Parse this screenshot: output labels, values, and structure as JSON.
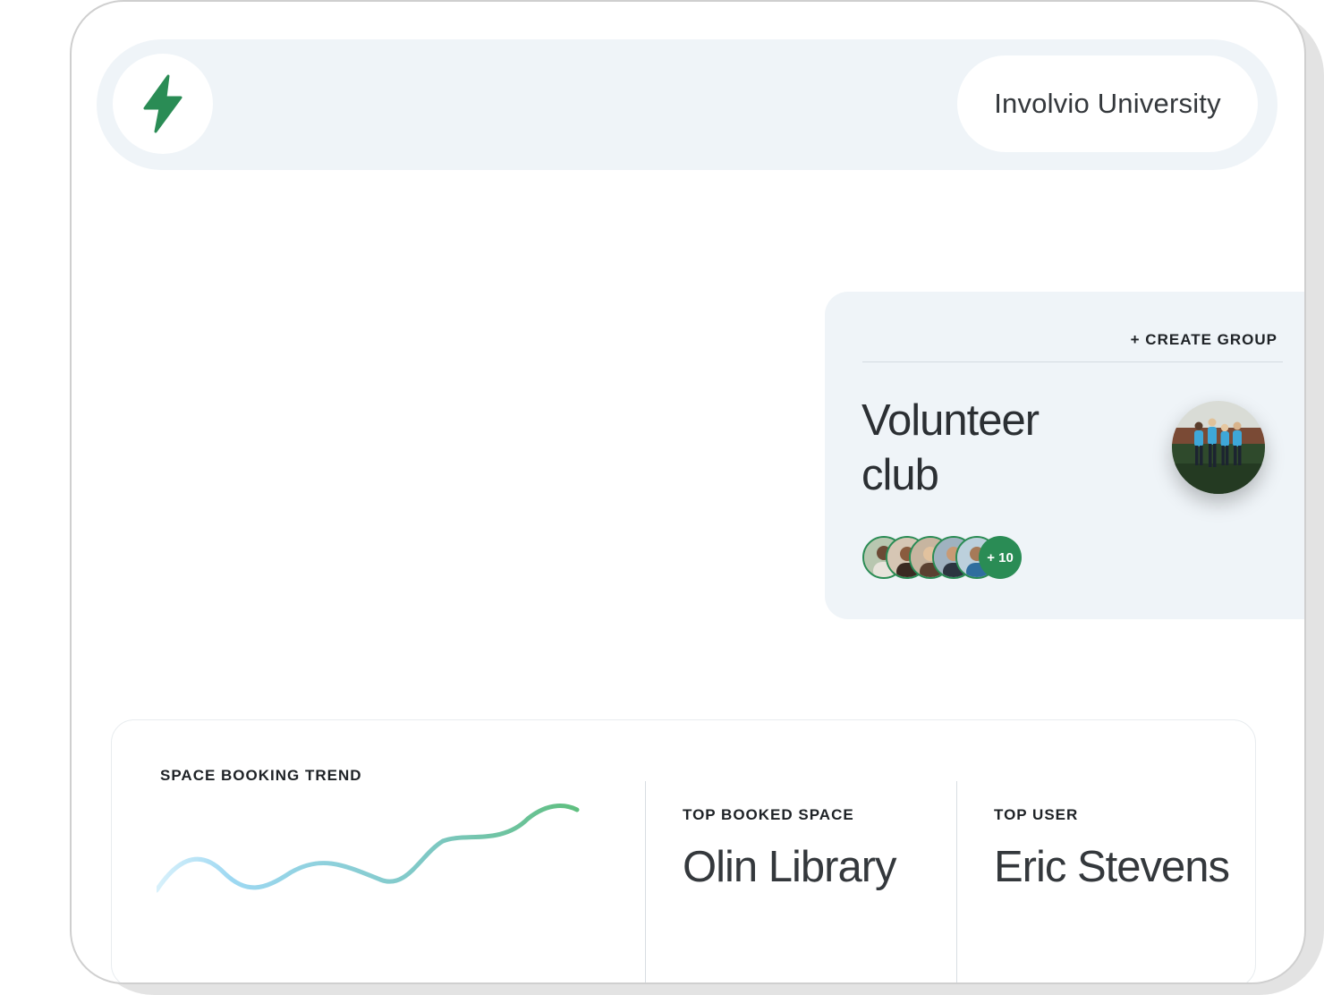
{
  "header": {
    "logo_icon": "lightning-bolt-icon",
    "accent_color": "#2a8c55",
    "org_name": "Involvio University"
  },
  "group_card": {
    "create_label": "+ CREATE GROUP",
    "title": "Volunteer club",
    "photo": "group-photo",
    "member_avatars": 5,
    "more_label": "+ 10"
  },
  "stats": {
    "trend_label": "SPACE BOOKING TREND",
    "top_space_label": "TOP BOOKED SPACE",
    "top_space_value": "Olin Library",
    "top_user_label": "TOP USER",
    "top_user_value": "Eric Stevens"
  }
}
